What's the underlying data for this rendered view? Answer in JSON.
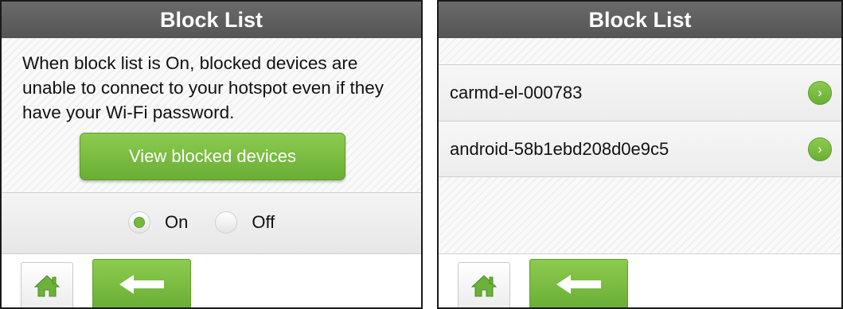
{
  "left_screen": {
    "title": "Block List",
    "description": "When block list is On, blocked devices are unable to connect to your hotspot even if they have your Wi-Fi password.",
    "view_button_label": "View blocked devices",
    "radio_on_label": "On",
    "radio_off_label": "Off",
    "selected": "On"
  },
  "right_screen": {
    "title": "Block List",
    "devices": [
      {
        "name": "carmd-el-000783"
      },
      {
        "name": "android-58b1ebd208d0e9c5"
      }
    ]
  },
  "icons": {
    "home": "home-icon",
    "back": "back-arrow-icon",
    "chevron": "chevron-right-icon"
  },
  "colors": {
    "accent_green": "#7cbd42",
    "titlebar_gray": "#5f5f5f"
  }
}
